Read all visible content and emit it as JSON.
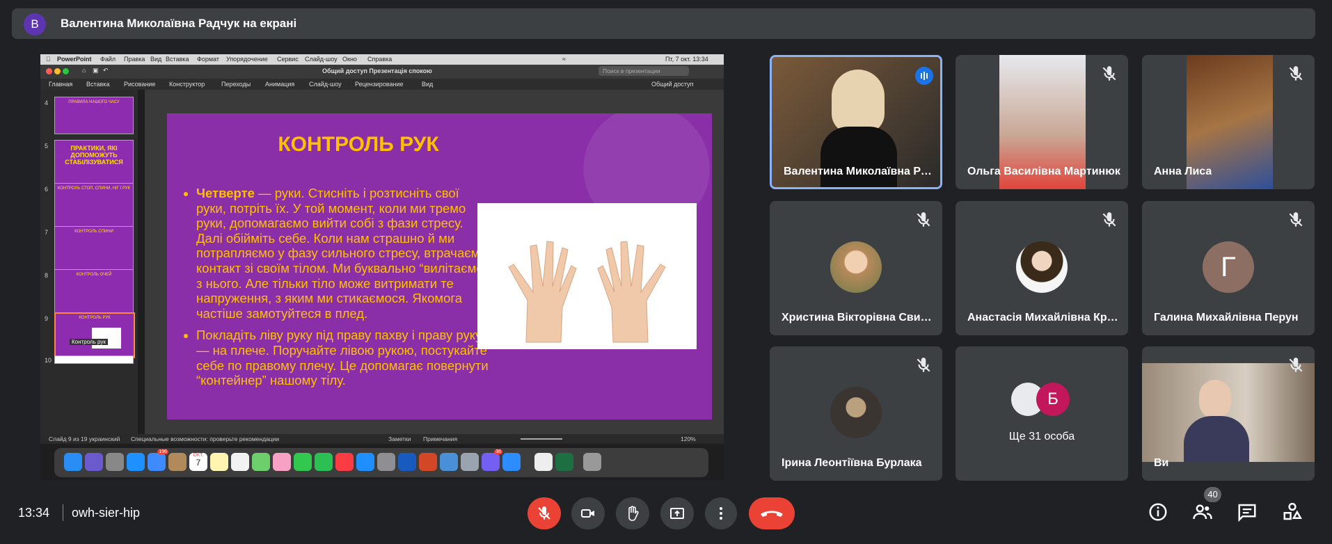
{
  "banner": {
    "avatar_letter": "В",
    "title": "Валентина Миколаївна Радчук на екрані"
  },
  "screen": {
    "menubar": [
      "PowerPoint",
      "Файл",
      "Правка",
      "Вид",
      "Вставка",
      "Формат",
      "Упорядочение",
      "Сервис",
      "Слайд-шоу",
      "Окно",
      "Справка"
    ],
    "clock": "Пт, 7 окт. 13:34",
    "doc_title": "Общий доступ Презентація спокою",
    "search_placeholder": "Поиск в презентации",
    "share_label": "Общий доступ",
    "ribbon_tabs": [
      "Главная",
      "Вставка",
      "Рисование",
      "Конструктор",
      "Переходы",
      "Анимация",
      "Слайд-шоу",
      "Рецензирование",
      "Вид"
    ],
    "thumbnails": [
      {
        "num": "4",
        "text": "ПРАВИЛА НАШОГО ЧАСУ"
      },
      {
        "num": "5",
        "text": "ПРАКТИКИ, ЯКІ ДОПОМОЖУТЬ СТАБІЛІЗУВАТИСЯ"
      },
      {
        "num": "6",
        "text": "КОНТРОЛЬ СТОП, СПИНИ, НІГ І РУК"
      },
      {
        "num": "7",
        "text": "КОНТРОЛЬ СПИНИ"
      },
      {
        "num": "8",
        "text": "КОНТРОЛЬ ОЧЕЙ"
      },
      {
        "num": "9",
        "text": "КОНТРОЛЬ РУК"
      },
      {
        "num": "10",
        "text": ""
      }
    ],
    "thumb_tooltip": "Контроль рук",
    "slide": {
      "title": "КОНТРОЛЬ РУК",
      "bullet1_bold": "Четверте",
      "bullet1_rest": " — руки. Стисніть і розтисніть свої руки, потріть їх. У той момент, коли ми тремо руки, допомагаємо вийти собі з фази стресу. Далі обійміть себе. Коли нам страшно й ми потрапляємо у фазу сильного стресу, втрачаємо контакт зі своїм тілом. Ми буквально “вилітаємо” з нього. Але тільки тіло може витримати те напруження, з яким ми стикаємося. Якомога частіше замотуйтеся в плед.",
      "bullet2": "Покладіть ліву руку під праву пахву і праву руку — на плече. Поручайте лівою рукою, постукайте себе по правому плечу. Це допомагає повернути “контейнер” нашому тілу."
    },
    "status": {
      "slide_of": "Слайд 9 из 19",
      "lang": "украинский",
      "accessibility": "Специальные возможности: проверьте рекомендации",
      "notes": "Заметки",
      "comments": "Примечания",
      "zoom": "120%"
    },
    "dock_badges": {
      "mail": "196",
      "viber": "36"
    },
    "calendar_month": "ОКТ.",
    "calendar_day": "7"
  },
  "participants": [
    {
      "name": "Валентина Миколаївна Радчук",
      "speaking": true
    },
    {
      "name": "Ольга Василівна Мартинюк",
      "muted": true
    },
    {
      "name": "Анна Лиса",
      "muted": true
    },
    {
      "name": "Христина Вікторівна Свистун",
      "muted": true
    },
    {
      "name": "Анастасія Михайлівна Кравець",
      "muted": true
    },
    {
      "name": "Галина Михайлівна Перун",
      "muted": true,
      "letter": "Г"
    },
    {
      "name": "Ірина Леонтіївна Бурлака",
      "muted": true
    },
    {
      "name": "Ще 31 особа",
      "letter": "Б"
    },
    {
      "name": "Ви",
      "muted": true
    }
  ],
  "bottom": {
    "time": "13:34",
    "meeting_code": "owh-sier-hip",
    "people_count": "40"
  },
  "colors": {
    "background": "#202124",
    "tile": "#3c4043",
    "danger": "#ea4335",
    "active_border": "#8ab4f8",
    "slide_bg": "#8a2fa8",
    "slide_text": "#ffc000"
  }
}
